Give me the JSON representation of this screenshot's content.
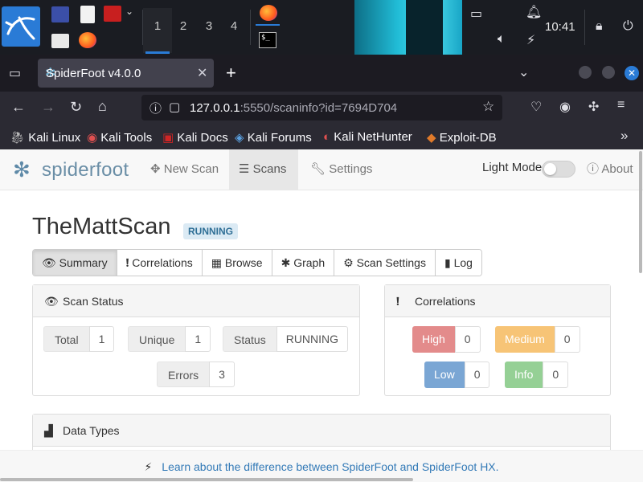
{
  "panel": {
    "workspaces": [
      "1",
      "2",
      "3",
      "4"
    ],
    "active_workspace": "1",
    "clock": "10:41",
    "terminal_icon_text": "$_"
  },
  "browser": {
    "tab_title": "SpiderFoot v4.0.0",
    "url_host": "127.0.0.1",
    "url_rest": ":5550/scaninfo?id=7694D704",
    "bookmarks": [
      "Kali Linux",
      "Kali Tools",
      "Kali Docs",
      "Kali Forums",
      "Kali NetHunter",
      "Exploit-DB"
    ]
  },
  "sf_nav": {
    "logo": "spiderfoot",
    "new_scan": "New Scan",
    "scans": "Scans",
    "settings": "Settings",
    "light_mode": "Light Mode",
    "about": "About"
  },
  "scan": {
    "name": "TheMattScan",
    "status_badge": "RUNNING",
    "tabs": [
      "Summary",
      "Correlations",
      "Browse",
      "Graph",
      "Scan Settings",
      "Log"
    ],
    "active_tab": "Summary"
  },
  "scan_status": {
    "title": "Scan Status",
    "total_label": "Total",
    "total": "1",
    "unique_label": "Unique",
    "unique": "1",
    "status_label": "Status",
    "status": "RUNNING",
    "errors_label": "Errors",
    "errors": "3"
  },
  "correlations": {
    "title": "Correlations",
    "high_label": "High",
    "high": "0",
    "medium_label": "Medium",
    "medium": "0",
    "low_label": "Low",
    "low": "0",
    "info_label": "Info",
    "info": "0",
    "colors": {
      "high": "#e38b8b",
      "medium": "#f7c476",
      "low": "#7aa6d4",
      "info": "#95d095"
    }
  },
  "data_types": {
    "title": "Data Types"
  },
  "footer": {
    "text": "Learn about the difference between SpiderFoot and SpiderFoot HX."
  }
}
